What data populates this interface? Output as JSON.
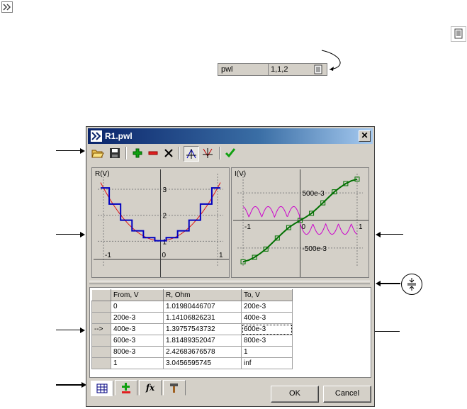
{
  "property_row": {
    "name": "pwl",
    "value": "1,1,2"
  },
  "window": {
    "title": "R1.pwl",
    "close_symbol": "✕"
  },
  "toolbar": {
    "open_icon": "folder-open-icon",
    "save_icon": "floppy-disk-icon",
    "add_icon": "plus-icon",
    "remove_icon": "minus-icon",
    "delete_icon": "cross-icon",
    "view1_icon": "curve-view-icon",
    "view2_icon": "curve-view-alt-icon",
    "apply_icon": "check-icon"
  },
  "left_plot": {
    "ylabel": "R(V)",
    "yticks": [
      "3",
      "2",
      "1"
    ],
    "xticks": [
      "-1",
      "0",
      "1"
    ]
  },
  "right_plot": {
    "ylabel": "I(V)",
    "yticks": [
      "500e-3",
      "-500e-3"
    ],
    "xticks": [
      "-1",
      "0",
      "1"
    ]
  },
  "chart_data": [
    {
      "type": "line",
      "ylabel": "R(V)",
      "xlim": [
        -1.1,
        1.1
      ],
      "ylim": [
        0,
        3.6
      ],
      "grid": true,
      "series": [
        {
          "name": "",
          "x": [
            -1,
            -0.8,
            -0.6,
            -0.4,
            -0.2,
            0,
            0.2,
            0.4,
            0.6,
            0.8,
            1
          ],
          "values": [
            3.05,
            2.43,
            1.81,
            1.4,
            1.14,
            1.02,
            1.14,
            1.4,
            1.81,
            2.43,
            3.05
          ]
        }
      ]
    },
    {
      "type": "line",
      "ylabel": "I(V)",
      "xlim": [
        -1.1,
        1.1
      ],
      "ylim": [
        -0.85,
        0.85
      ],
      "grid": true,
      "series": [
        {
          "name": "",
          "x": [
            -1,
            -0.9,
            -0.8,
            -0.7,
            -0.6,
            -0.5,
            -0.4,
            -0.3,
            -0.2,
            -0.1,
            0,
            0.1,
            0.2,
            0.3,
            0.4,
            0.5,
            0.6,
            0.7,
            0.8,
            0.9,
            1
          ],
          "values": [
            -0.75,
            -0.72,
            -0.67,
            -0.6,
            -0.52,
            -0.42,
            -0.32,
            -0.22,
            -0.13,
            -0.06,
            0,
            0.06,
            0.13,
            0.22,
            0.32,
            0.42,
            0.52,
            0.6,
            0.67,
            0.72,
            0.75
          ]
        }
      ]
    }
  ],
  "table": {
    "columns": [
      "From, V",
      "R, Ohm",
      "To, V"
    ],
    "rows": [
      {
        "marker": "",
        "from": "0",
        "r": "1.01980446707",
        "to": "200e-3"
      },
      {
        "marker": "",
        "from": "200e-3",
        "r": "1.14106826231",
        "to": "400e-3"
      },
      {
        "marker": "-->",
        "from": "400e-3",
        "r": "1.39757543732",
        "to": "600e-3"
      },
      {
        "marker": "",
        "from": "600e-3",
        "r": "1.81489352047",
        "to": "800e-3"
      },
      {
        "marker": "",
        "from": "800e-3",
        "r": "2.42683676578",
        "to": "1"
      },
      {
        "marker": "",
        "from": "1",
        "r": "3.0456595745",
        "to": "inf"
      }
    ]
  },
  "tabs": [
    {
      "icon": "table-icon"
    },
    {
      "icon": "add-row-icon"
    },
    {
      "icon": "fx-icon",
      "label": "fx"
    },
    {
      "icon": "hammer-icon"
    }
  ],
  "buttons": {
    "ok": "OK",
    "cancel": "Cancel"
  },
  "colors": {
    "title_bar": "#0a246a",
    "step_line": "#0000c0",
    "smooth_line": "#e01010",
    "iv_line": "#007000",
    "pink_wave": "#cc00cc",
    "plot_bg": "#d4d0c8"
  }
}
